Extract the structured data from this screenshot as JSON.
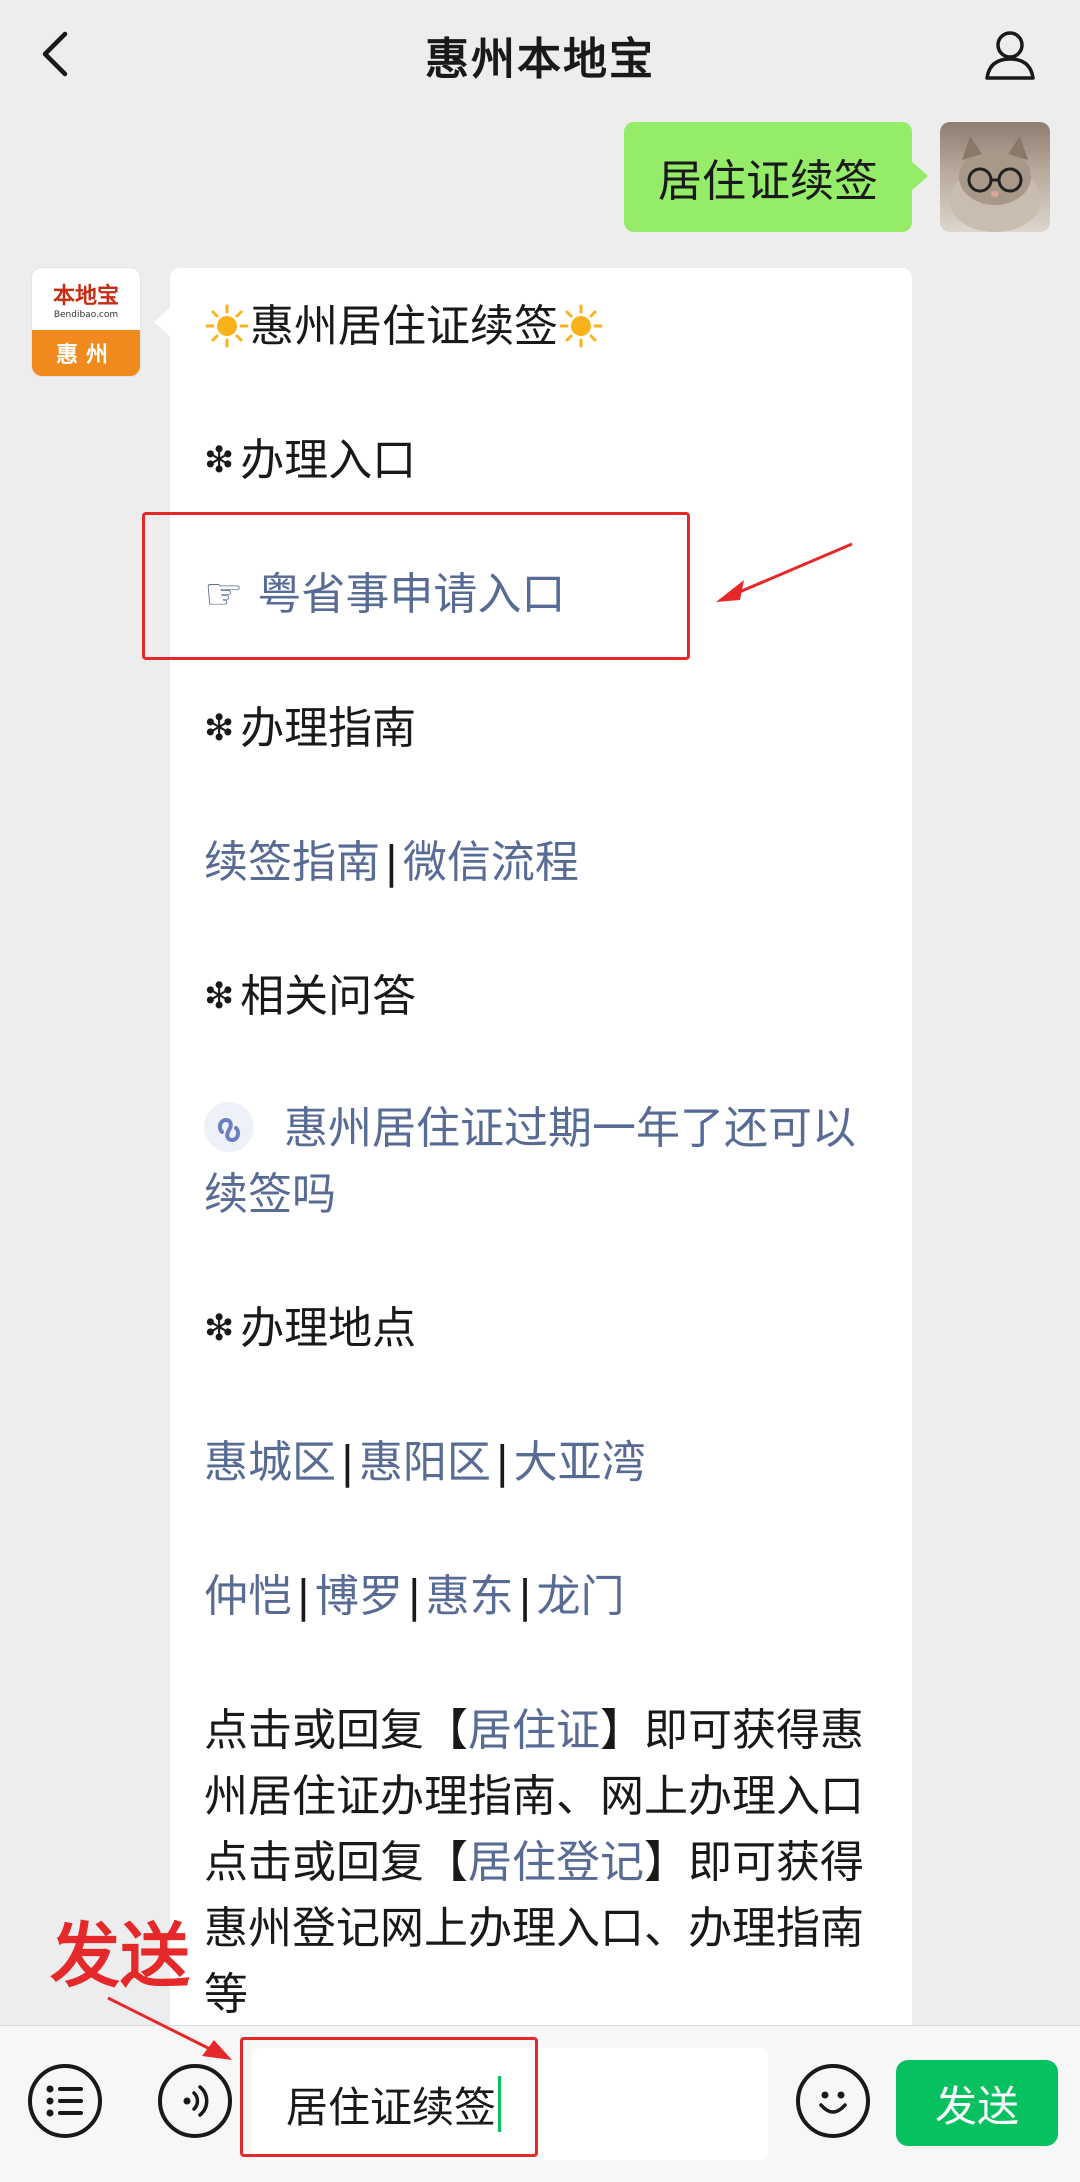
{
  "header": {
    "title": "惠州本地宝",
    "back_icon": "chevron-left-icon",
    "profile_icon": "person-icon"
  },
  "outgoing": {
    "text": "居住证续签"
  },
  "bot": {
    "avatar_brand": "本地宝",
    "avatar_site": "Bendibao.com",
    "avatar_city": "惠州"
  },
  "message": {
    "title": "惠州居住证续签",
    "section1": "办理入口",
    "entry_link": "☞ 粤省事申请入口",
    "section2": "办理指南",
    "guide_links": [
      "续签指南",
      "微信流程"
    ],
    "section3": "相关问答",
    "qa_line1": "惠州居住证过期一年了还可以",
    "qa_line2": "续签吗",
    "section4": "办理地点",
    "places_row1": [
      "惠城区",
      "惠阳区",
      "大亚湾"
    ],
    "places_row2": [
      "仲恺",
      "博罗",
      "惠东",
      "龙门"
    ],
    "para1_pre": "点击或回复【",
    "para1_link": "居住证",
    "para1_post": "】即可获得惠",
    "para1_line2": "州居住证办理指南、网上办理入口",
    "para2_pre": "点击或回复【",
    "para2_link": "居住登记",
    "para2_post": "】即可获得",
    "para2_line2": "惠州登记网上办理入口、办理指南",
    "para2_line3": "等"
  },
  "annotation": {
    "send_label": "发送"
  },
  "input": {
    "value": "居住证续签",
    "send_label": "发送"
  },
  "colors": {
    "link": "#576b95",
    "outgoing_bubble": "#95ec69",
    "send_button": "#07c160",
    "annotation": "#e5282a"
  }
}
